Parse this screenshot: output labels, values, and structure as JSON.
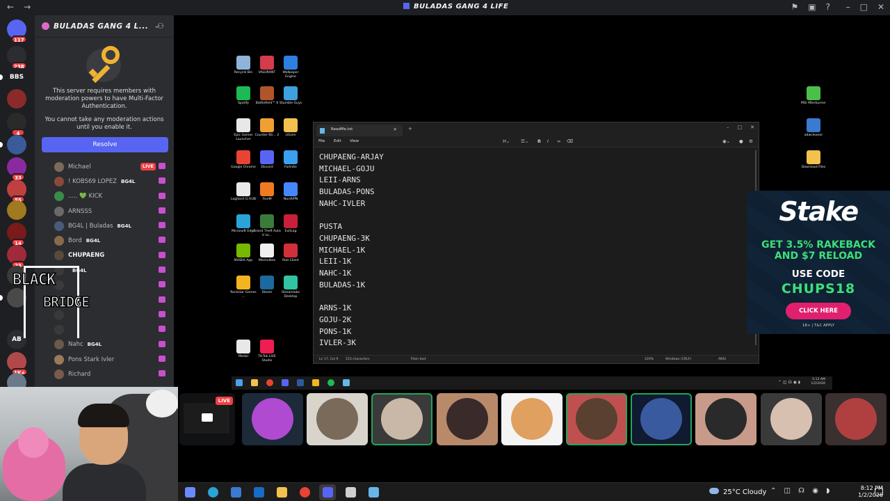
{
  "window": {
    "title": "BULADAS GANG 4 LIFE"
  },
  "rail": {
    "servers": [
      {
        "label": "",
        "badge": "117",
        "color": "#5865f2"
      },
      {
        "label": "",
        "badge": "238",
        "color": "#2b2d31"
      },
      {
        "label": "BBS",
        "badge": "",
        "color": "#1e1f22"
      },
      {
        "label": "",
        "badge": "",
        "color": "#8a2a2a"
      },
      {
        "label": "",
        "badge": "4",
        "color": "#2a2a2a"
      },
      {
        "label": "",
        "badge": "",
        "color": "#3a5a9a"
      },
      {
        "label": "",
        "badge": "33",
        "color": "#8a2aa0"
      },
      {
        "label": "",
        "badge": "55",
        "color": "#c04040"
      },
      {
        "label": "",
        "badge": "",
        "color": "#a07a20"
      },
      {
        "label": "",
        "badge": "14",
        "color": "#7a1a1a"
      },
      {
        "label": "",
        "badge": "23",
        "color": "#a02a3a"
      },
      {
        "label": "",
        "badge": "",
        "color": "#3a3a3a"
      },
      {
        "label": "",
        "badge": "",
        "color": "#4a4a4a"
      },
      {
        "label": "AB",
        "badge": "",
        "color": "#2b2d31"
      },
      {
        "label": "",
        "badge": "1K+",
        "color": "#b04a4a"
      },
      {
        "label": "",
        "badge": "",
        "color": "#6a7a8a"
      }
    ]
  },
  "server": {
    "name": "BULADAS GANG 4 L...",
    "mfa_message": "This server requires members with moderation powers to have Multi-Factor Authentication.",
    "mfa_note": "You cannot take any moderation actions until you enable it.",
    "resolve_label": "Resolve"
  },
  "members": [
    {
      "name": "Michael",
      "tag": "",
      "live": "LIVE",
      "avatar_color": "#7a6a5a"
    },
    {
      "name": "! KOBS69 LOPEZ",
      "tag": "BG4L",
      "live": "",
      "avatar_color": "#8a4a3a"
    },
    {
      "name": "..... 💚 KICK",
      "tag": "",
      "live": "",
      "avatar_color": "#3a8a4a"
    },
    {
      "name": "ARNSSS",
      "tag": "",
      "live": "",
      "avatar_color": "#6a6a6a"
    },
    {
      "name": "BG4L | Buladas",
      "tag": "BG4L",
      "live": "",
      "avatar_color": "#4a5a7a"
    },
    {
      "name": "Bord",
      "tag": "BG4L",
      "live": "",
      "avatar_color": "#8a6a4a"
    },
    {
      "name": "CHUPAENG",
      "tag": "",
      "live": "",
      "avatar_color": "#5a4a3a"
    },
    {
      "name": "",
      "tag": "BG4L",
      "live": "",
      "avatar_color": "#3a3a3a"
    },
    {
      "name": "",
      "tag": "",
      "live": "",
      "avatar_color": "#3a3a3a"
    },
    {
      "name": "",
      "tag": "",
      "live": "",
      "avatar_color": "#3a3a3a"
    },
    {
      "name": "",
      "tag": "",
      "live": "",
      "avatar_color": "#3a3a3a"
    },
    {
      "name": "",
      "tag": "",
      "live": "",
      "avatar_color": "#3a3a3a"
    },
    {
      "name": "Nahc",
      "tag": "BG4L",
      "live": "",
      "avatar_color": "#6a5a4a"
    },
    {
      "name": "Pons Stark Ivler",
      "tag": "",
      "live": "",
      "avatar_color": "#9a7a5a"
    },
    {
      "name": "Richard",
      "tag": "",
      "live": "",
      "avatar_color": "#7a5a4a"
    }
  ],
  "overlay": {
    "line1": "BLACK",
    "line2": "BRIDGE"
  },
  "desktop_icons": [
    {
      "label": "Recycle Bin",
      "color": "#8fb3d9"
    },
    {
      "label": "VALORANT",
      "color": "#d33c4c"
    },
    {
      "label": "Wallpaper Engine",
      "color": "#2f7fe0"
    },
    {
      "label": "Spotify",
      "color": "#1db954"
    },
    {
      "label": "Battlefield™ 6",
      "color": "#b0552a"
    },
    {
      "label": "Stumble Guys",
      "color": "#3fa0e0"
    },
    {
      "label": "Epic Games Launcher",
      "color": "#e8e8e8"
    },
    {
      "label": "Counter-Str... 2",
      "color": "#f0a030"
    },
    {
      "label": "citizen",
      "color": "#f2c14e"
    },
    {
      "label": "Google Chrome",
      "color": "#e94335"
    },
    {
      "label": "Discord",
      "color": "#5865f2"
    },
    {
      "label": "Fortnite",
      "color": "#3aa0f0"
    },
    {
      "label": "Logitech G HUB",
      "color": "#e8e8e8"
    },
    {
      "label": "FiveM",
      "color": "#f07a20"
    },
    {
      "label": "NordVPN",
      "color": "#4687ff"
    },
    {
      "label": "Microsoft Edge",
      "color": "#2aa4d8"
    },
    {
      "label": "Grand Theft Auto V Le...",
      "color": "#3a7a3a"
    },
    {
      "label": "ExitLag",
      "color": "#c8203a"
    },
    {
      "label": "NVIDIA App",
      "color": "#76b900"
    },
    {
      "label": "Mechvibes",
      "color": "#f0f0f0"
    },
    {
      "label": "Riot Client",
      "color": "#d1303a"
    },
    {
      "label": "Rockstar Games ...",
      "color": "#f2b420"
    },
    {
      "label": "Steam",
      "color": "#1b6a9e"
    },
    {
      "label": "Streamlabs Desktop",
      "color": "#31c3a2"
    },
    {
      "label": "Medal",
      "color": "#e8e8e8"
    },
    {
      "label": "TikTok LIVE Studio",
      "color": "#ee1d52"
    },
    {
      "label": "MSI Afterburner",
      "color": "#4ac04a"
    },
    {
      "label": "adwcleaner",
      "color": "#3a7ad0"
    },
    {
      "label": "Download Files",
      "color": "#f2c14e"
    }
  ],
  "notepad": {
    "tab_title": "ReadMe.txt",
    "menu": [
      "File",
      "Edit",
      "View"
    ],
    "content": "CHUPAENG-ARJAY\nMICHAEL-GOJU\nLEII-ARNS\nBULADAS-PONS\nNAHC-IVLER\n\nPUSTA\nCHUPAENG-3K\nMICHAEL-1K\nLEII-1K\nNAHC-1K\nBULADAS-1K\n\nARNS-1K\nGOJU-2K\nPONS-1K\nIVLER-3K",
    "status": {
      "position": "Ln 17, Col 9",
      "characters": "153 characters",
      "format": "Plain text",
      "zoom": "220%",
      "line_ending": "Windows (CRLF)",
      "encoding": "ANSI"
    }
  },
  "ad": {
    "brand": "Stake",
    "line1": "GET 3.5% RAKEBACK",
    "line2": "AND $7 RELOAD",
    "use_code": "USE CODE",
    "code": "CHUPS18",
    "cta": "CLICK HERE",
    "fine": "18+ | T&C APPLY"
  },
  "inner_taskbar": {
    "time": "5:13 AM",
    "date": "1/2/2026"
  },
  "participants": {
    "share_live": "LIVE",
    "tiles": [
      {
        "color": "#1c2a3a",
        "face": "#b04ad0",
        "speaking": false
      },
      {
        "color": "#d8d4cc",
        "face": "#7a6a5a",
        "speaking": false
      },
      {
        "color": "#3a3a3a",
        "face": "#c9b8a8",
        "speaking": true
      },
      {
        "color": "#b88a6a",
        "face": "#3a2a2a",
        "speaking": false
      },
      {
        "color": "#f4f4f4",
        "face": "#e0a060",
        "speaking": false
      },
      {
        "color": "#c05050",
        "face": "#5a4030",
        "speaking": true
      },
      {
        "color": "#101a30",
        "face": "#3a5aa0",
        "speaking": true
      },
      {
        "color": "#c89a8a",
        "face": "#2a2a2a",
        "speaking": false
      },
      {
        "color": "#3a3a3a",
        "face": "#d8c0b0",
        "speaking": false
      },
      {
        "color": "#3a3030",
        "face": "#b04040",
        "speaking": false
      }
    ]
  },
  "taskbar": {
    "weather": "25°C  Cloudy",
    "time": "8:12 PM",
    "date": "1/2/2026",
    "apps": [
      {
        "name": "copilot-icon",
        "color": "#6a8aff"
      },
      {
        "name": "edge-icon",
        "color": "#2aa4d8"
      },
      {
        "name": "store-icon",
        "color": "#3a7ad0"
      },
      {
        "name": "outlook-icon",
        "color": "#1a6ac8"
      },
      {
        "name": "explorer-icon",
        "color": "#f2c14e"
      },
      {
        "name": "chrome-icon",
        "color": "#e94335"
      },
      {
        "name": "discord-icon",
        "color": "#5865f2"
      },
      {
        "name": "obs-icon",
        "color": "#d0d0d0"
      },
      {
        "name": "notepad-icon",
        "color": "#67b6ea"
      }
    ]
  }
}
